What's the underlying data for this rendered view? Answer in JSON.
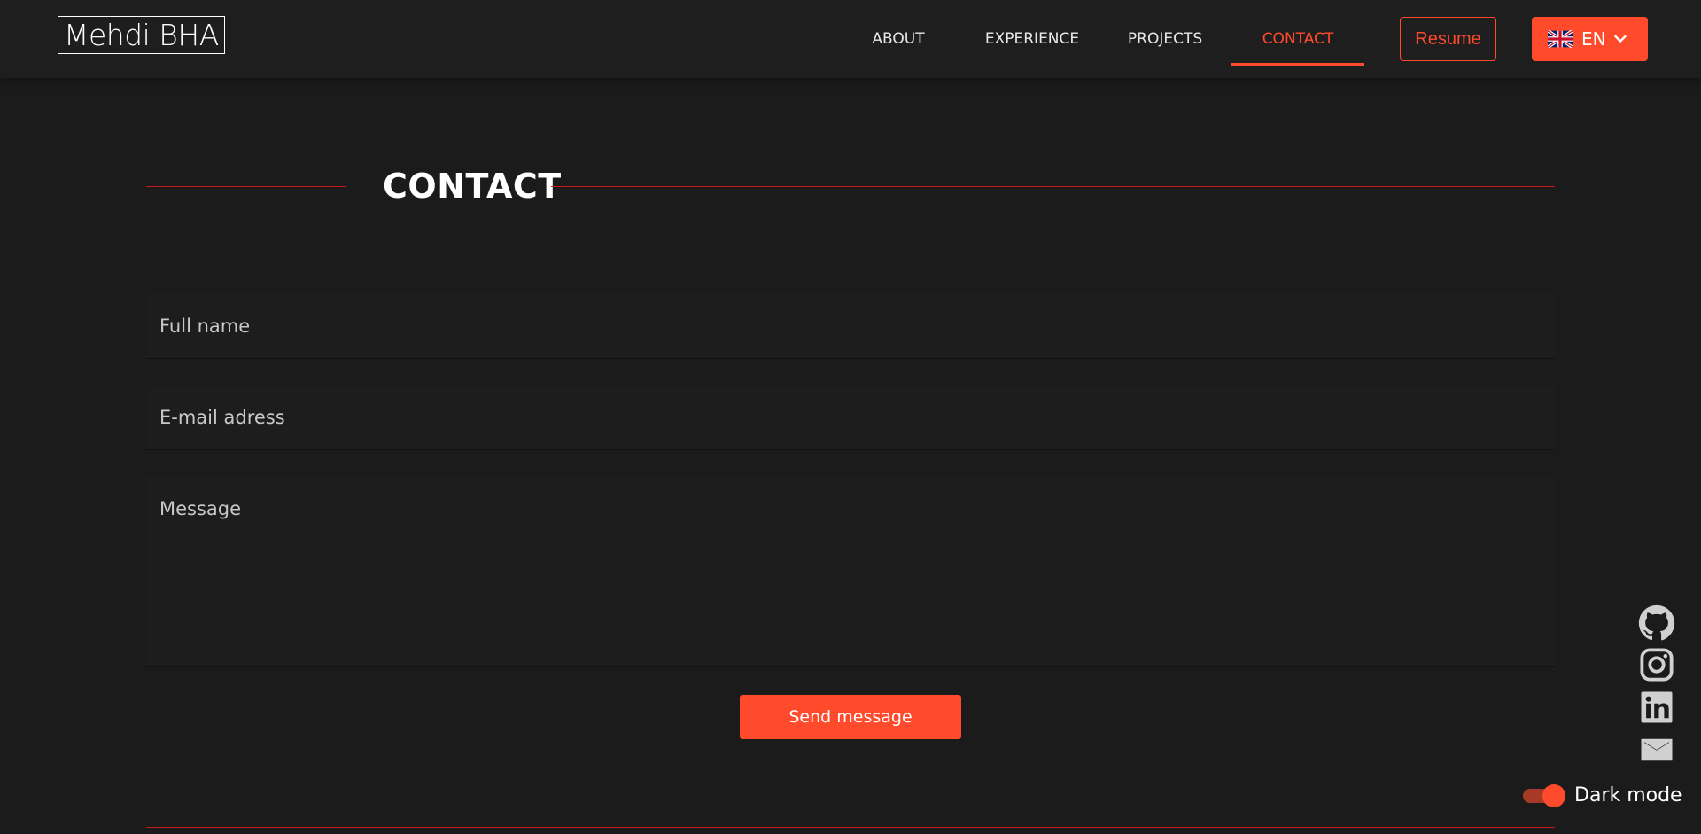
{
  "header": {
    "logo": "Mehdi BHA",
    "nav": [
      {
        "label": "ABOUT",
        "active": false
      },
      {
        "label": "EXPERIENCE",
        "active": false
      },
      {
        "label": "PROJECTS",
        "active": false
      },
      {
        "label": "CONTACT",
        "active": true
      }
    ],
    "resume_label": "Resume",
    "language": {
      "code": "EN",
      "flag": "uk-flag-icon"
    }
  },
  "contact": {
    "title": "CONTACT",
    "name_placeholder": "Full name",
    "name_value": "",
    "email_placeholder": "E-mail adress",
    "email_value": "",
    "message_placeholder": "Message",
    "message_value": "",
    "send_label": "Send message"
  },
  "social": [
    {
      "name": "github-icon"
    },
    {
      "name": "instagram-icon"
    },
    {
      "name": "linkedin-icon"
    },
    {
      "name": "mail-icon"
    }
  ],
  "theme": {
    "label": "Dark mode",
    "dark_mode_on": true
  },
  "colors": {
    "accent": "#ff4b2b",
    "background": "#1b1b1b",
    "header": "#1e1e1e",
    "rule": "#c41a1a",
    "icon": "#d0d0d0"
  }
}
